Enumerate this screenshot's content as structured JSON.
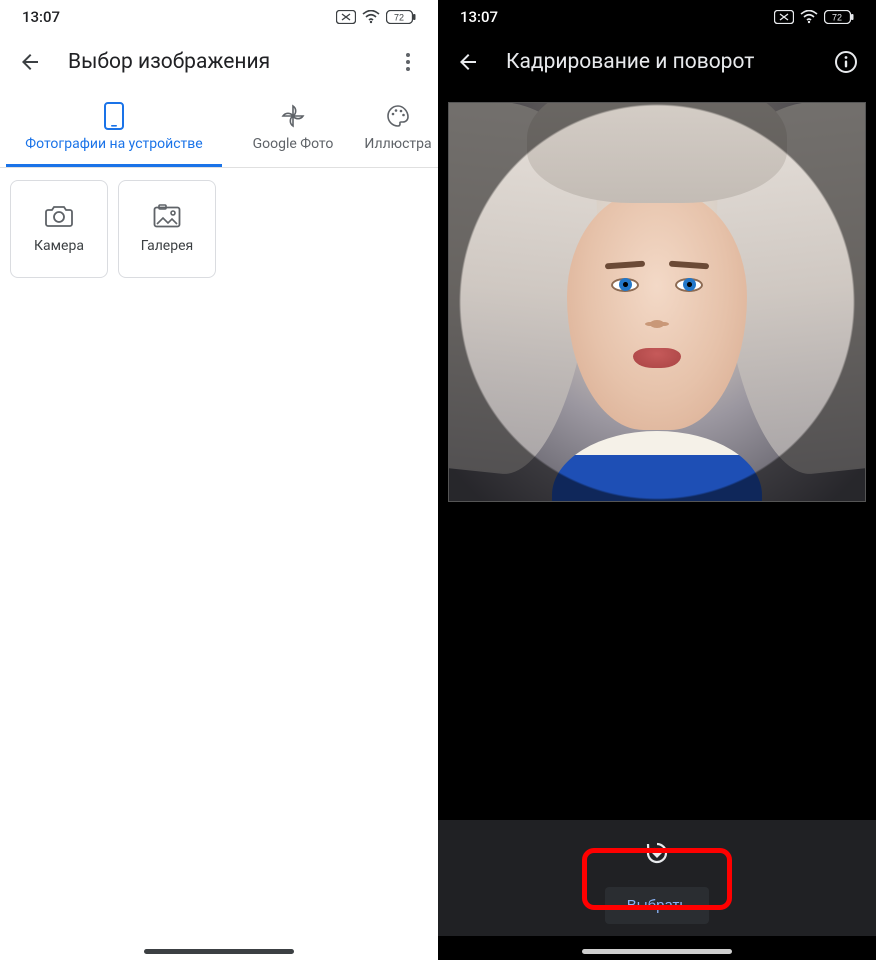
{
  "left": {
    "status": {
      "time": "13:07",
      "battery": "72"
    },
    "header": {
      "title": "Выбор изображения"
    },
    "tabs": [
      {
        "label": "Фотографии на устройстве"
      },
      {
        "label": "Google Фото"
      },
      {
        "label": "Иллюстра"
      }
    ],
    "tiles": {
      "camera": "Камера",
      "gallery": "Галерея"
    }
  },
  "right": {
    "status": {
      "time": "13:07",
      "battery": "72"
    },
    "header": {
      "title": "Кадрирование и поворот"
    },
    "actions": {
      "select": "Выбрать"
    }
  }
}
